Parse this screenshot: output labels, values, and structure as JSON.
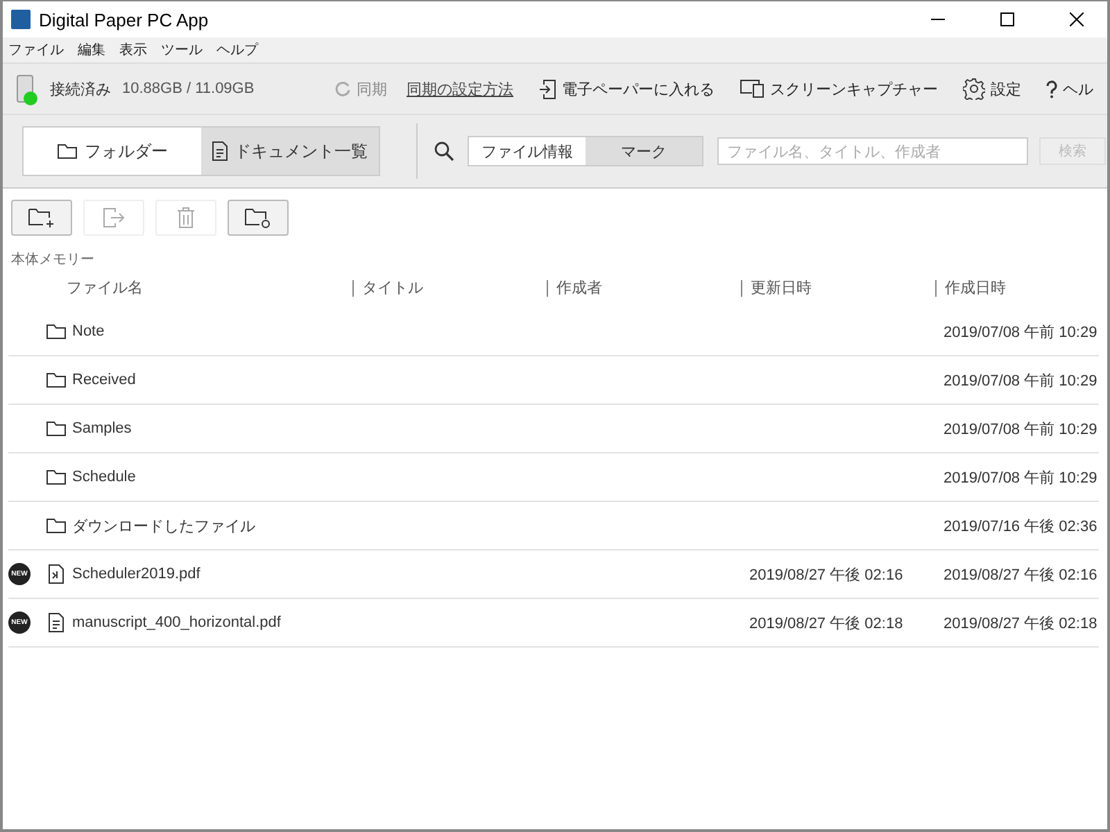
{
  "window": {
    "title": "Digital Paper PC App"
  },
  "menu": [
    "ファイル",
    "編集",
    "表示",
    "ツール",
    "ヘルプ"
  ],
  "status": {
    "connection": "接続済み",
    "connected": true,
    "storage": "10.88GB / 11.09GB"
  },
  "actions": [
    {
      "kind": "sync",
      "label": "同期",
      "disabled": true
    },
    {
      "kind": "link",
      "label": "同期の設定方法"
    },
    {
      "kind": "import",
      "label": "電子ペーパーに入れる"
    },
    {
      "kind": "capture",
      "label": "スクリーンキャプチャー"
    },
    {
      "kind": "settings",
      "label": "設定"
    },
    {
      "kind": "help",
      "label": "ヘル"
    }
  ],
  "view_tabs": [
    {
      "kind": "folder",
      "label": "フォルダー",
      "selected": true
    },
    {
      "kind": "document",
      "label": "ドキュメント一覧",
      "selected": false
    }
  ],
  "search": {
    "tabs": [
      {
        "label": "ファイル情報",
        "selected": true
      },
      {
        "label": "マーク",
        "selected": false
      }
    ],
    "placeholder": "ファイル名、タイトル、作成者",
    "button": "検索",
    "button_disabled": true
  },
  "toolbar": [
    {
      "kind": "new-folder",
      "disabled": false
    },
    {
      "kind": "export",
      "disabled": true
    },
    {
      "kind": "delete",
      "disabled": true
    },
    {
      "kind": "sync-folder",
      "disabled": false
    }
  ],
  "location": "本体メモリー",
  "table": {
    "columns": [
      "ファイル名",
      "タイトル",
      "作成者",
      "更新日時",
      "作成日時"
    ],
    "rows": [
      {
        "kind": "folder",
        "name": "Note",
        "created": "2019/07/08 午前 10:29"
      },
      {
        "kind": "folder",
        "name": "Received",
        "created": "2019/07/08 午前 10:29"
      },
      {
        "kind": "folder",
        "name": "Samples",
        "created": "2019/07/08 午前 10:29"
      },
      {
        "kind": "folder",
        "name": "Schedule",
        "created": "2019/07/08 午前 10:29"
      },
      {
        "kind": "folder",
        "name": "ダウンロードしたファイル",
        "created": "2019/07/16 午後 02:36"
      },
      {
        "kind": "calendar",
        "badge": "NEW",
        "name": "Scheduler2019.pdf",
        "updated": "2019/08/27 午後 02:16",
        "created": "2019/08/27 午後 02:16"
      },
      {
        "kind": "document",
        "badge": "NEW",
        "name": "manuscript_400_horizontal.pdf",
        "updated": "2019/08/27 午後 02:18",
        "created": "2019/08/27 午後 02:18"
      }
    ]
  }
}
